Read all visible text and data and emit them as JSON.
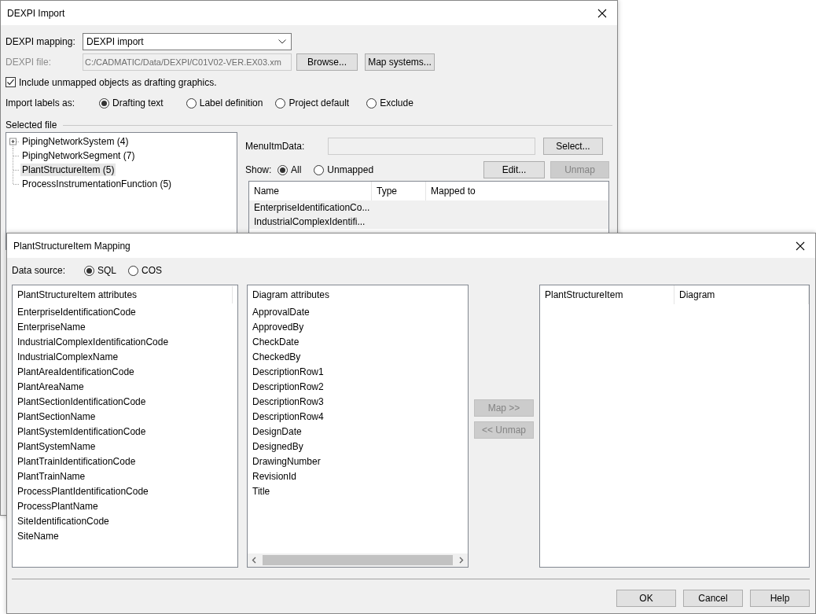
{
  "import_dialog": {
    "title": "DEXPI Import",
    "mapping": {
      "label": "DEXPI mapping:",
      "value": "DEXPI import"
    },
    "file": {
      "label": "DEXPI file:",
      "value": "C:/CADMATIC/Data/DEXPI/C01V02-VER.EX03.xm",
      "disabled": true
    },
    "file_buttons": [
      {
        "label": "Browse...",
        "disabled": false
      },
      {
        "label": "Map systems...",
        "disabled": false
      }
    ],
    "include_unmapped": {
      "label": "Include unmapped objects as drafting graphics.",
      "checked": true
    },
    "import_labels": {
      "label": "Import labels as:",
      "options": [
        {
          "label": "Drafting text",
          "selected": true
        },
        {
          "label": "Label definition",
          "selected": false
        },
        {
          "label": "Project default",
          "selected": false
        },
        {
          "label": "Exclude",
          "selected": false
        }
      ]
    },
    "selected_file": {
      "title": "Selected file",
      "tree": [
        {
          "label": "PipingNetworkSystem (4)",
          "kind": "collapsed",
          "selected": false
        },
        {
          "label": "PipingNetworkSegment (7)",
          "kind": "leaf",
          "selected": false
        },
        {
          "label": "PlantStructureItem (5)",
          "kind": "leaf",
          "selected": true
        },
        {
          "label": "ProcessInstrumentationFunction (5)",
          "kind": "leaf",
          "selected": false
        }
      ],
      "menu_item_data": {
        "label": "MenuItmData:",
        "button": "Select..."
      },
      "show": {
        "label": "Show:",
        "options": [
          {
            "label": "All",
            "selected": true
          },
          {
            "label": "Unmapped",
            "selected": false
          }
        ]
      },
      "actions": [
        {
          "label": "Edit...",
          "disabled": false
        },
        {
          "label": "Unmap",
          "disabled": true
        }
      ],
      "table": {
        "columns": [
          "Name",
          "Type",
          "Mapped to"
        ],
        "rows": [
          {
            "name": "EnterpriseIdentificationCo..."
          },
          {
            "name": "IndustrialComplexIdentifi..."
          }
        ]
      }
    }
  },
  "mapping_dialog": {
    "title": "PlantStructureItem Mapping",
    "data_source": {
      "label": "Data source:",
      "options": [
        {
          "label": "SQL",
          "selected": true
        },
        {
          "label": "COS",
          "selected": false
        }
      ]
    },
    "source_list": {
      "header": "PlantStructureItem attributes",
      "items": [
        "EnterpriseIdentificationCode",
        "EnterpriseName",
        "IndustrialComplexIdentificationCode",
        "IndustrialComplexName",
        "PlantAreaIdentificationCode",
        "PlantAreaName",
        "PlantSectionIdentificationCode",
        "PlantSectionName",
        "PlantSystemIdentificationCode",
        "PlantSystemName",
        "PlantTrainIdentificationCode",
        "PlantTrainName",
        "ProcessPlantIdentificationCode",
        "ProcessPlantName",
        "SiteIdentificationCode",
        "SiteName"
      ]
    },
    "target_list": {
      "header": "Diagram attributes",
      "items": [
        "ApprovalDate",
        "ApprovedBy",
        "CheckDate",
        "CheckedBy",
        "DescriptionRow1",
        "DescriptionRow2",
        "DescriptionRow3",
        "DescriptionRow4",
        "DesignDate",
        "DesignedBy",
        "DrawingNumber",
        "RevisionId",
        "Title"
      ]
    },
    "move_buttons": [
      {
        "label": "Map >>",
        "disabled": true
      },
      {
        "label": "<< Unmap",
        "disabled": true
      }
    ],
    "result_table": {
      "columns": [
        "PlantStructureItem",
        "Diagram"
      ]
    },
    "footer_buttons": [
      {
        "label": "OK",
        "disabled": false
      },
      {
        "label": "Cancel",
        "disabled": false
      },
      {
        "label": "Help",
        "disabled": false
      }
    ]
  }
}
